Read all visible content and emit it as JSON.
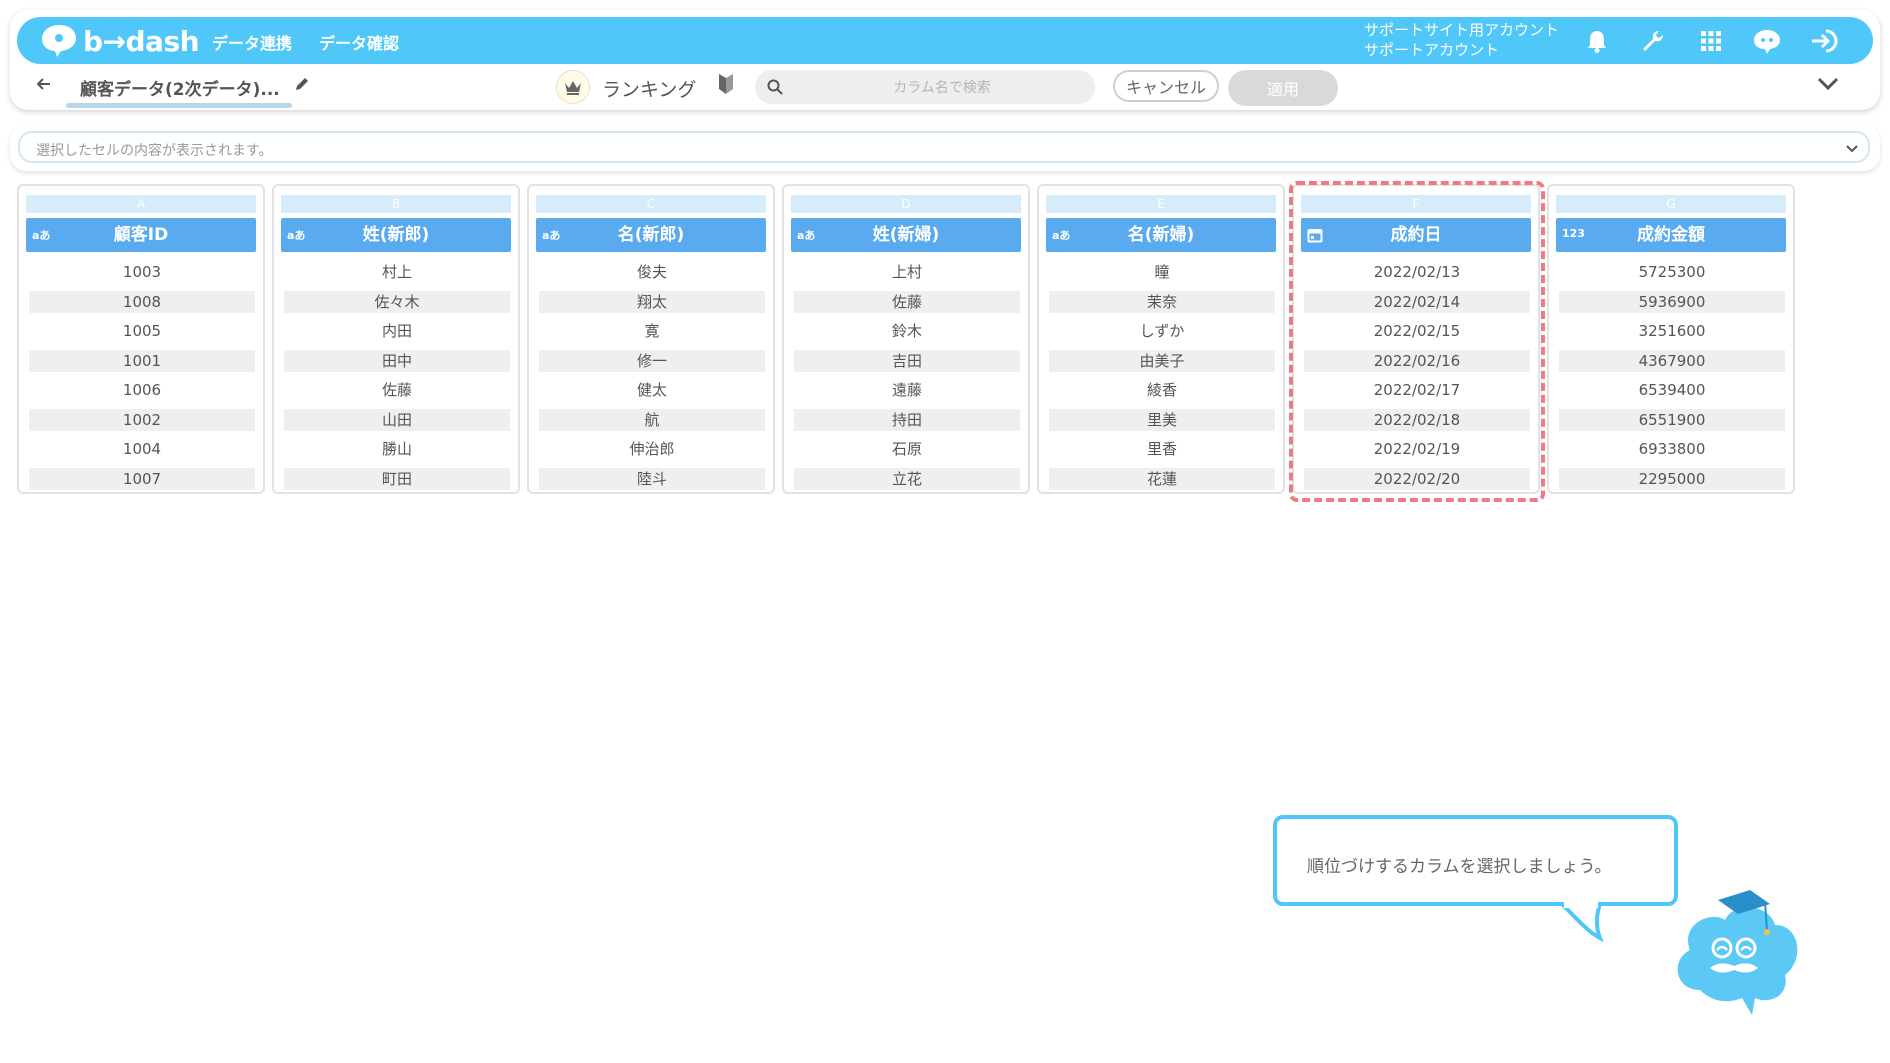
{
  "brand": {
    "logo_text": "b→dash"
  },
  "nav": [
    {
      "label": "データ連携"
    },
    {
      "label": "データ確認"
    }
  ],
  "account": {
    "line1": "サポートサイト用アカウント",
    "line2": "サポートアカウント"
  },
  "top_icons": [
    "bell-icon",
    "wrench-icon",
    "grid-icon",
    "chat-icon",
    "logout-icon"
  ],
  "toolbar": {
    "dataset_name": "顧客データ(2次データ)...",
    "ranking_label": "ランキング",
    "search_placeholder": "カラム名で検索",
    "cancel_label": "キャンセル",
    "apply_label": "適用"
  },
  "cell_bar": {
    "placeholder": "選択したセルの内容が表示されます。"
  },
  "columns": [
    {
      "letter": "A",
      "type": "aあ",
      "title": "顧客ID",
      "rows": [
        "1003",
        "1008",
        "1005",
        "1001",
        "1006",
        "1002",
        "1004",
        "1007"
      ]
    },
    {
      "letter": "B",
      "type": "aあ",
      "title": "姓(新郎)",
      "rows": [
        "村上",
        "佐々木",
        "内田",
        "田中",
        "佐藤",
        "山田",
        "勝山",
        "町田"
      ]
    },
    {
      "letter": "C",
      "type": "aあ",
      "title": "名(新郎)",
      "rows": [
        "俊夫",
        "翔太",
        "寛",
        "修一",
        "健太",
        "航",
        "伸治郎",
        "陸斗"
      ]
    },
    {
      "letter": "D",
      "type": "aあ",
      "title": "姓(新婦)",
      "rows": [
        "上村",
        "佐藤",
        "鈴木",
        "吉田",
        "遠藤",
        "持田",
        "石原",
        "立花"
      ]
    },
    {
      "letter": "E",
      "type": "aあ",
      "title": "名(新婦)",
      "rows": [
        "瞳",
        "茉奈",
        "しずか",
        "由美子",
        "綾香",
        "里美",
        "里香",
        "花蓮"
      ]
    },
    {
      "letter": "F",
      "type": "calendar",
      "title": "成約日",
      "rows": [
        "2022/02/13",
        "2022/02/14",
        "2022/02/15",
        "2022/02/16",
        "2022/02/17",
        "2022/02/18",
        "2022/02/19",
        "2022/02/20"
      ]
    },
    {
      "letter": "G",
      "type": "123",
      "title": "成約金額",
      "rows": [
        "5725300",
        "5936900",
        "3251600",
        "4367900",
        "6539400",
        "6551900",
        "6933800",
        "2295000"
      ]
    }
  ],
  "tooltip": {
    "text": "順位づけするカラムを選択しましょう。"
  },
  "colors": {
    "accent": "#4fc7f8",
    "header": "#5aaaf0",
    "highlight": "#f07a84"
  }
}
